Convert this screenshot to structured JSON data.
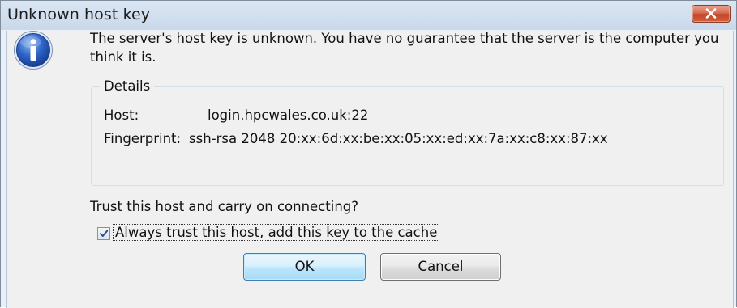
{
  "window": {
    "title": "Unknown host key",
    "close_icon": "close-icon"
  },
  "dialog": {
    "icon": "info-icon",
    "message": "The server's host key is unknown. You have no guarantee that the server is the computer you think it is.",
    "details": {
      "title": "Details",
      "host_label": "Host:",
      "host_value": "login.hpcwales.co.uk:22",
      "fingerprint_label": "Fingerprint:",
      "fingerprint_value": "ssh-rsa 2048 20:xx:6d:xx:be:xx:05:xx:ed:xx:7a:xx:c8:xx:87:xx"
    },
    "question": "Trust this host and carry on connecting?",
    "checkbox": {
      "label": "Always trust this host, add this key to the cache",
      "checked": true
    },
    "buttons": {
      "ok": "OK",
      "cancel": "Cancel"
    }
  },
  "colors": {
    "title_bar": "#c9d8ea",
    "close_button": "#c24628",
    "client_background": "#f0f0f0",
    "default_button_border": "#3c7fb1"
  }
}
